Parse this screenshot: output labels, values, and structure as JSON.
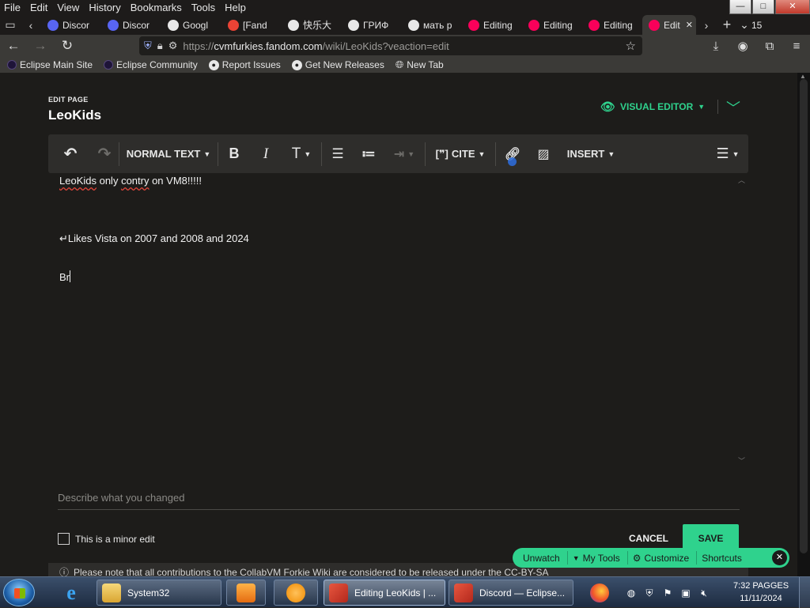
{
  "menu": [
    "File",
    "Edit",
    "View",
    "History",
    "Bookmarks",
    "Tools",
    "Help"
  ],
  "window_controls": {
    "minimize": "—",
    "maximize": "□",
    "close": "✕"
  },
  "tabs": [
    {
      "label": "Discor",
      "icon": "discord-icon",
      "color": "#5865f2"
    },
    {
      "label": "Discor",
      "icon": "discord-icon",
      "color": "#5865f2"
    },
    {
      "label": "Googl",
      "icon": "google-icon",
      "color": "#e8e8e8"
    },
    {
      "label": "[Fand",
      "icon": "gmail-icon",
      "color": "#ea4335"
    },
    {
      "label": "快乐大",
      "icon": "cat-icon",
      "color": "#e8e8e8"
    },
    {
      "label": "ГРИФ",
      "icon": "youtube-icon",
      "color": "#e8e8e8"
    },
    {
      "label": "мать р",
      "icon": "google-icon",
      "color": "#e8e8e8"
    },
    {
      "label": "Editing",
      "icon": "fandom-icon",
      "color": "#fa005a"
    },
    {
      "label": "Editing",
      "icon": "fandom-icon",
      "color": "#fa005a"
    },
    {
      "label": "Editing",
      "icon": "fandom-icon",
      "color": "#fa005a"
    },
    {
      "label": "Edit",
      "icon": "fandom-icon",
      "color": "#fa005a",
      "active": true
    }
  ],
  "tab_count": "15",
  "url": {
    "prefix": "https://",
    "host": "cvmfurkies.fandom.com",
    "path": "/wiki/LeoKids?veaction=edit"
  },
  "bookmarks": [
    {
      "label": "Eclipse Main Site",
      "icon": "eclipse-icon"
    },
    {
      "label": "Eclipse Community",
      "icon": "eclipse-icon"
    },
    {
      "label": "Report Issues",
      "icon": "github-icon"
    },
    {
      "label": "Get New Releases",
      "icon": "github-icon"
    },
    {
      "label": "New Tab",
      "icon": "globe-icon"
    }
  ],
  "editor": {
    "edit_label": "EDIT PAGE",
    "page_title": "LeoKids",
    "mode": "VISUAL EDITOR",
    "toolbar": {
      "paragraph": "NORMAL TEXT",
      "cite": "CITE",
      "insert": "INSERT"
    },
    "content": {
      "line1_spell": "LeoKids",
      "line1_mid": " only ",
      "line1_spell2": "contry",
      "line1_end": " on VM8!!!!!",
      "line2": "↵Likes Vista on 2007 and 2008 and 2024",
      "line3": "Br"
    },
    "summary_placeholder": "Describe what you changed",
    "minor_edit": "This is a minor edit",
    "cancel": "CANCEL",
    "save": "SAVE",
    "notice": "Please note that all contributions to the CollabVM Forkie Wiki are considered to be released under the CC-BY-SA"
  },
  "fandom_bar": {
    "unwatch": "Unwatch",
    "my_tools": "My Tools",
    "customize": "Customize",
    "shortcuts": "Shortcuts"
  },
  "taskbar": {
    "items": [
      {
        "label": "System32",
        "icon": "folder-icon"
      },
      {
        "label": "Editing LeoKids | ...",
        "icon": "firefox-icon"
      },
      {
        "label": "Discord — Eclipse...",
        "icon": "firefox-icon"
      }
    ],
    "clock_time": "7:32 PAGGES",
    "clock_date": "11/11/2024"
  }
}
